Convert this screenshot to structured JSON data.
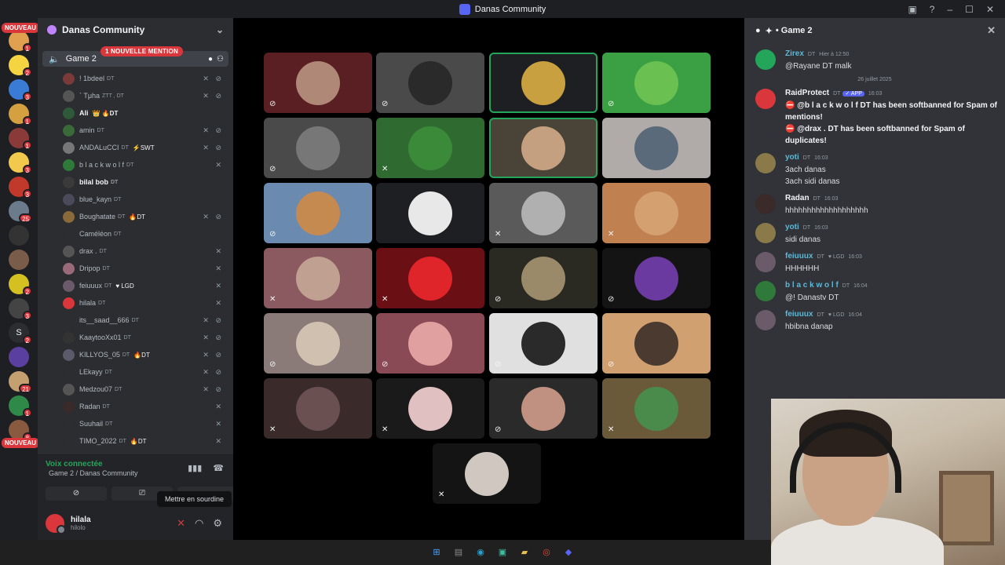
{
  "window": {
    "title": "Danas Community",
    "controls": [
      "▣",
      "?",
      "–",
      "☐",
      "✕"
    ]
  },
  "guilds": {
    "nouveau_top": "NOUVEAU",
    "nouveau_bottom": "NOUVEAU",
    "items": [
      {
        "color": "#e0a050",
        "badge": "1"
      },
      {
        "color": "#f5d442",
        "badge": "2"
      },
      {
        "color": "#3a7bd5",
        "badge": "3"
      },
      {
        "color": "#d4a040",
        "badge": "1"
      },
      {
        "color": "#8b3a3a",
        "badge": "1"
      },
      {
        "color": "#f2c94c",
        "badge": "3"
      },
      {
        "color": "#c0392b",
        "badge": "3"
      },
      {
        "color": "#6b7b8c",
        "badge": "25"
      },
      {
        "color": "#333333",
        "badge": ""
      },
      {
        "color": "#7a5c4a",
        "badge": ""
      },
      {
        "color": "#d4c020",
        "badge": "2"
      },
      {
        "color": "#444444",
        "badge": "3"
      },
      {
        "color": "#2b2d31",
        "badge": "2",
        "letter": "S"
      },
      {
        "color": "#5b3fa0",
        "badge": ""
      },
      {
        "color": "#c4a070",
        "badge": "21"
      },
      {
        "color": "#2f8a4a",
        "badge": "1"
      },
      {
        "color": "#8a5a40",
        "badge": "8"
      }
    ]
  },
  "sidebar": {
    "server_name": "Danas Community",
    "voice_channel": "Game 2",
    "mention_pill": "1 NOUVELLE MENTION",
    "users": [
      {
        "name": "! 1bdeel",
        "tag": "DT",
        "extra": "",
        "color": "#7a3a3a",
        "icons": "✕ ⊘",
        "bold": false
      },
      {
        "name": "` Tμha",
        "tag": "ZTT , DT",
        "extra": "",
        "color": "#555555",
        "icons": "✕ ⊘",
        "bold": false
      },
      {
        "name": "Ali",
        "tag": "",
        "extra": "👑 🔥DT",
        "color": "#2f5a3a",
        "icons": "",
        "bold": true
      },
      {
        "name": "amin",
        "tag": "DT",
        "extra": "",
        "color": "#3a6a3a",
        "icons": "✕ ⊘",
        "bold": false
      },
      {
        "name": "ANDALuCCI",
        "tag": "DT",
        "extra": "⚡SWT",
        "color": "#777777",
        "icons": "✕ ⊘",
        "bold": false
      },
      {
        "name": "b l a c k w o l f",
        "tag": "DT",
        "extra": "",
        "color": "#2f7a3a",
        "icons": "✕",
        "bold": false
      },
      {
        "name": "bilal bob",
        "tag": "DT",
        "extra": "",
        "color": "#3a3a3a",
        "icons": "",
        "bold": true
      },
      {
        "name": "blue_kayn",
        "tag": "DT",
        "extra": "",
        "color": "#4a4a5a",
        "icons": "",
        "bold": false
      },
      {
        "name": "Boughatate",
        "tag": "DT",
        "extra": "🔥DT",
        "color": "#8a6a3a",
        "icons": "✕ ⊘",
        "bold": false
      },
      {
        "name": "Caméléon",
        "tag": "DT",
        "extra": "",
        "color": "#2b2d31",
        "icons": "",
        "bold": false
      },
      {
        "name": "drax .",
        "tag": "DT",
        "extra": "",
        "color": "#555555",
        "icons": "✕",
        "bold": false
      },
      {
        "name": "Dripop",
        "tag": "DT",
        "extra": "",
        "color": "#9a6a7a",
        "icons": "✕",
        "bold": false
      },
      {
        "name": "feiuuux",
        "tag": "DT",
        "extra": "♥ LGD",
        "color": "#6a5a6a",
        "icons": "✕",
        "bold": false
      },
      {
        "name": "hilala",
        "tag": "DT",
        "extra": "",
        "color": "#da373c",
        "icons": "✕",
        "bold": false
      },
      {
        "name": "its__saad__666",
        "tag": "DT",
        "extra": "",
        "color": "#2b2d31",
        "icons": "✕ ⊘",
        "bold": false
      },
      {
        "name": "KaaytooXx01",
        "tag": "DT",
        "extra": "",
        "color": "#333333",
        "icons": "✕ ⊘",
        "bold": false
      },
      {
        "name": "KILLYOS_05",
        "tag": "DT",
        "extra": "🔥DT",
        "color": "#5a5a6a",
        "icons": "✕ ⊘",
        "bold": false
      },
      {
        "name": "LEkayy",
        "tag": "DT",
        "extra": "",
        "color": "#2b2d31",
        "icons": "✕ ⊘",
        "bold": false
      },
      {
        "name": "Medzou07",
        "tag": "DT",
        "extra": "",
        "color": "#555555",
        "icons": "✕ ⊘",
        "bold": false
      },
      {
        "name": "Radan",
        "tag": "DT",
        "extra": "",
        "color": "#3a2a2a",
        "icons": "✕",
        "bold": false
      },
      {
        "name": "Suuhail",
        "tag": "DT",
        "extra": "",
        "color": "#2b2d31",
        "icons": "✕",
        "bold": false
      },
      {
        "name": "TIMO_2022",
        "tag": "DT",
        "extra": "🔥DT",
        "color": "#2b2d31",
        "icons": "✕",
        "bold": false
      }
    ],
    "voice_status": "Voix connectée",
    "voice_channel_full": "Game 2 / Danas Community",
    "user_name": "hilala",
    "user_sub": "hilolo",
    "tooltip": "Mettre en sourdine"
  },
  "stage": {
    "tiles": [
      {
        "bg": "#5a1f22",
        "av": "#b08878",
        "speaking": false,
        "muted": "⊘"
      },
      {
        "bg": "#4a4a4a",
        "av": "#2a2a2a",
        "speaking": false,
        "muted": "⊘"
      },
      {
        "bg": "#1e1f22",
        "av": "#c8a040",
        "speaking": true,
        "muted": ""
      },
      {
        "bg": "#3aa043",
        "av": "#6ac050",
        "speaking": false,
        "muted": "⊘"
      },
      {
        "bg": "#4a4a4a",
        "av": "#777777",
        "speaking": false,
        "muted": "⊘"
      },
      {
        "bg": "#2f6a30",
        "av": "#3a8a3a",
        "speaking": false,
        "muted": "✕"
      },
      {
        "bg": "#4a4438",
        "av": "#c4a080",
        "speaking": true,
        "muted": ""
      },
      {
        "bg": "#b0aba8",
        "av": "#5a6a7a",
        "speaking": false,
        "muted": ""
      },
      {
        "bg": "#6a8ab0",
        "av": "#c48a50",
        "speaking": false,
        "muted": "⊘"
      },
      {
        "bg": "#1e1f22",
        "av": "#e8e8e8",
        "speaking": false,
        "muted": ""
      },
      {
        "bg": "#5a5a5a",
        "av": "#b0b0b0",
        "speaking": false,
        "muted": "✕"
      },
      {
        "bg": "#c08050",
        "av": "#d4a070",
        "speaking": false,
        "muted": "✕"
      },
      {
        "bg": "#8a5a60",
        "av": "#c0a090",
        "speaking": false,
        "muted": "✕"
      },
      {
        "bg": "#6a1015",
        "av": "#e0252a",
        "speaking": false,
        "muted": "✕"
      },
      {
        "bg": "#2a2a22",
        "av": "#9a8a6a",
        "speaking": false,
        "muted": "⊘"
      },
      {
        "bg": "#141414",
        "av": "#6a3aa0",
        "speaking": false,
        "muted": "⊘"
      },
      {
        "bg": "#8a7a78",
        "av": "#d0c0b0",
        "speaking": false,
        "muted": "⊘"
      },
      {
        "bg": "#8a4a55",
        "av": "#e0a0a0",
        "speaking": false,
        "muted": "⊘"
      },
      {
        "bg": "#e0e0e0",
        "av": "#2a2a2a",
        "speaking": false,
        "muted": "⊘"
      },
      {
        "bg": "#d0a070",
        "av": "#4a3a30",
        "speaking": false,
        "muted": "⊘"
      },
      {
        "bg": "#3a2a2a",
        "av": "#6a5050",
        "speaking": false,
        "muted": "✕"
      },
      {
        "bg": "#1a1a1a",
        "av": "#e0c0c0",
        "speaking": false,
        "muted": "✕"
      },
      {
        "bg": "#2a2a2a",
        "av": "#c09080",
        "speaking": false,
        "muted": "⊘"
      },
      {
        "bg": "#6a5a3a",
        "av": "#4a8a4a",
        "speaking": false,
        "muted": "✕"
      },
      {
        "bg": "#141414",
        "av": "#d0c8c0",
        "speaking": false,
        "muted": "✕"
      }
    ]
  },
  "chat": {
    "channel": "• Game 2",
    "day_separator": "26 juillet 2025",
    "messages": [
      {
        "author": "Zirex",
        "tag": "DT",
        "time": "Hier à 12:50",
        "lines": [
          "@Rayane DT malk"
        ],
        "av": "#23a55a",
        "color": "#5fb8d6"
      },
      {
        "author": "RaidProtect",
        "tag": "DT",
        "app": "✓ APP",
        "time": "16:03",
        "lines": [
          "⛔ @b l a c k w o l f DT has been softbanned for Spam of mentions!",
          "⛔ @drax . DT has been softbanned for Spam of duplicates!"
        ],
        "av": "#da373c",
        "color": "#f2f3f5"
      },
      {
        "author": "yoti",
        "tag": "DT",
        "time": "16:03",
        "lines": [
          "3ach danas",
          "3ach sidi danas"
        ],
        "av": "#8a7a4a",
        "color": "#5fb8d6"
      },
      {
        "author": "Radan",
        "tag": "DT",
        "time": "16:03",
        "lines": [
          "hhhhhhhhhhhhhhhhhhh"
        ],
        "av": "#3a2a2a",
        "color": "#f2f3f5"
      },
      {
        "author": "yoti",
        "tag": "DT",
        "time": "16:03",
        "lines": [
          "sidi danas"
        ],
        "av": "#8a7a4a",
        "color": "#5fb8d6"
      },
      {
        "author": "feiuuux",
        "tag": "DT",
        "extra": "♥ LGD",
        "time": "16:03",
        "lines": [
          "HHHHHH"
        ],
        "av": "#6a5a6a",
        "color": "#5fb8d6"
      },
      {
        "author": "b l a c k w o l f",
        "tag": "DT",
        "time": "16:04",
        "lines": [
          "@! Danastv DT"
        ],
        "av": "#2f7a3a",
        "color": "#5fb8d6"
      },
      {
        "author": "feiuuux",
        "tag": "DT",
        "extra": "♥ LGD",
        "time": "16:04",
        "lines": [
          "hbibna danap"
        ],
        "av": "#6a5a6a",
        "color": "#5fb8d6"
      }
    ]
  },
  "taskbar": {
    "icons": [
      {
        "name": "windows-start-icon",
        "glyph": "⊞",
        "color": "#4aa3ff"
      },
      {
        "name": "file-icon",
        "glyph": "▤",
        "color": "#8a8a8a"
      },
      {
        "name": "edge-icon",
        "glyph": "◉",
        "color": "#2aa0d0"
      },
      {
        "name": "app-icon",
        "glyph": "▣",
        "color": "#3ac0a0"
      },
      {
        "name": "folder-icon",
        "glyph": "▰",
        "color": "#e8c04a"
      },
      {
        "name": "chrome-icon",
        "glyph": "◎",
        "color": "#e04a3a"
      },
      {
        "name": "discord-icon",
        "glyph": "◆",
        "color": "#5865f2"
      }
    ]
  }
}
